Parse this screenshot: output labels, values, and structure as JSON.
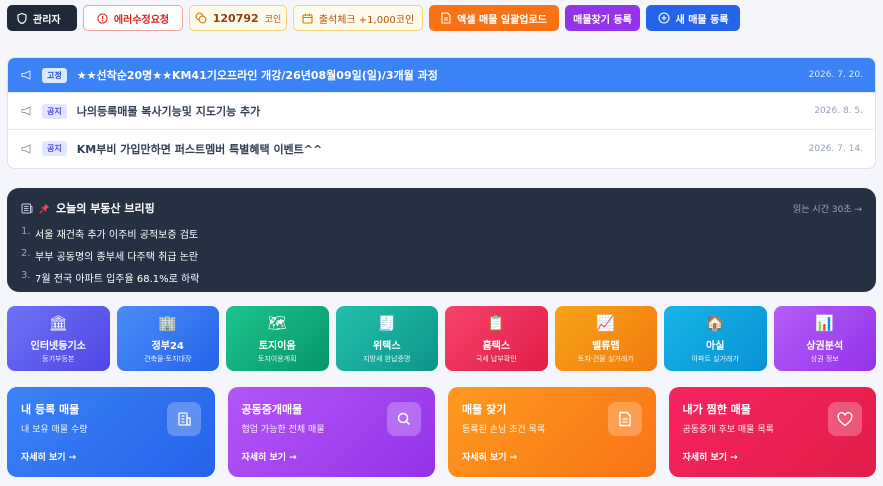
{
  "toolbar": {
    "admin_label": "관리자",
    "error_label": "에러수정요청",
    "coin_amount": "120792",
    "coin_unit": "코인",
    "attendance_label": "출석체크 +1,000코인",
    "excel_label": "엑셀 매물 일괄업로드",
    "find_label": "매물찾기 등록",
    "new_label": "새 매물 등록"
  },
  "notices": [
    {
      "tag": "고정",
      "title": "★★선착순20명★★KM41기오프라인 개강/26년08월09일(일)/3개월 과정",
      "date": "2026. 7. 20.",
      "pinned": true
    },
    {
      "tag": "공지",
      "title": "나의등록매물 복사기능및 지도기능 추가",
      "date": "2026. 8. 5.",
      "pinned": false
    },
    {
      "tag": "공지",
      "title": "KM부비 가입만하면 퍼스트멤버 특별혜택 이벤트^^",
      "date": "2026. 7. 14.",
      "pinned": false
    }
  ],
  "briefing": {
    "title": "오늘의 부동산 브리핑",
    "read_time": "읽는 시간 30초 →",
    "items": [
      "서울 재건축 추가 이주비 공적보증 검토",
      "부부 공동명의 종부세 다주택 취급 논란",
      "7월 전국 아파트 입주율 68.1%로 하락"
    ]
  },
  "tiles": [
    {
      "name": "인터넷등기소",
      "sub": "등기부등본",
      "icon": "bank-icon",
      "glyph": "🏛",
      "color": "#6366f1"
    },
    {
      "name": "정부24",
      "sub": "건축물·토지대장",
      "icon": "building-icon",
      "glyph": "🏢",
      "color": "#3b82f6"
    },
    {
      "name": "토지이음",
      "sub": "토지이용계획",
      "icon": "map-icon",
      "glyph": "🗺",
      "color": "#10b981"
    },
    {
      "name": "위택스",
      "sub": "지방세 완납증명",
      "icon": "receipt-icon",
      "glyph": "🧾",
      "color": "#14b8a6"
    },
    {
      "name": "홈택스",
      "sub": "국세 납부확인",
      "icon": "clipboard-icon",
      "glyph": "📋",
      "color": "#f43f5e"
    },
    {
      "name": "밸류맵",
      "sub": "토지·건물 실거래가",
      "icon": "chart-line-icon",
      "glyph": "📈",
      "color": "#f59e0b"
    },
    {
      "name": "아실",
      "sub": "아파트 실거래가",
      "icon": "house-icon",
      "glyph": "🏠",
      "color": "#0ea5e9"
    },
    {
      "name": "상권분석",
      "sub": "상권 정보",
      "icon": "bar-chart-icon",
      "glyph": "📊",
      "color": "#a855f7"
    }
  ],
  "cards": [
    {
      "title": "내 등록 매물",
      "sub": "내 보유 매물 수량",
      "more": "자세히 보기 →",
      "icon": "building-icon",
      "color": "#2f6df6"
    },
    {
      "title": "공동중개매물",
      "sub": "협업 가능한 전체 매물",
      "more": "자세히 보기 →",
      "icon": "search-icon",
      "color": "#a33ef0"
    },
    {
      "title": "매물 찾기",
      "sub": "등록된 손님 조건 목록",
      "more": "자세히 보기 →",
      "icon": "document-icon",
      "color": "#fb7d0a"
    },
    {
      "title": "내가 찜한 매물",
      "sub": "공동중개 후보 매물 목록",
      "more": "자세히 보기 →",
      "icon": "heart-icon",
      "color": "#f3124f"
    }
  ]
}
